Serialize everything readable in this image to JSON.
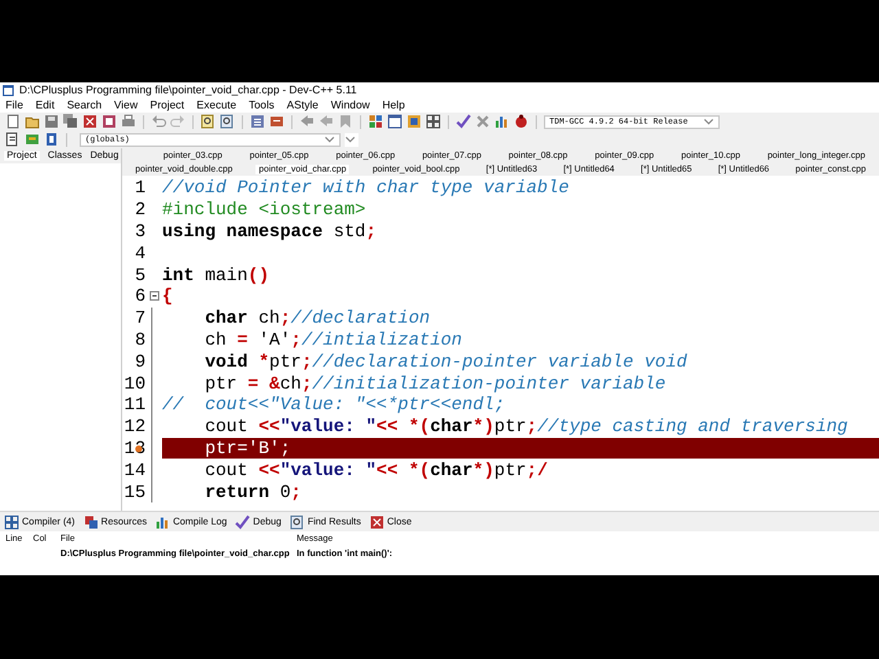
{
  "window": {
    "title": "D:\\CPlusplus Programming file\\pointer_void_char.cpp - Dev-C++ 5.11"
  },
  "menu": [
    "File",
    "Edit",
    "Search",
    "View",
    "Project",
    "Execute",
    "Tools",
    "AStyle",
    "Window",
    "Help"
  ],
  "compiler_select": {
    "value": "TDM-GCC 4.9.2 64-bit Release"
  },
  "scope_select": {
    "value": "(globals)"
  },
  "side_tabs": [
    {
      "label": "Project",
      "selected": true
    },
    {
      "label": "Classes",
      "selected": false
    },
    {
      "label": "Debug",
      "selected": false
    }
  ],
  "file_tab_rows": [
    {
      "tabs": [
        {
          "label": "pointer_03.cpp",
          "selected": false
        },
        {
          "label": "pointer_05.cpp",
          "selected": false
        },
        {
          "label": "pointer_06.cpp",
          "selected": false
        },
        {
          "label": "pointer_07.cpp",
          "selected": false
        },
        {
          "label": "pointer_08.cpp",
          "selected": false
        },
        {
          "label": "pointer_09.cpp",
          "selected": false
        },
        {
          "label": "pointer_10.cpp",
          "selected": false
        },
        {
          "label": "pointer_long_integer.cpp",
          "selected": false
        }
      ]
    },
    {
      "tabs": [
        {
          "label": "pointer_void_double.cpp",
          "selected": false
        },
        {
          "label": "pointer_void_char.cpp",
          "selected": true
        },
        {
          "label": "pointer_void_bool.cpp",
          "selected": false
        },
        {
          "label": "[*] Untitled63",
          "selected": false
        },
        {
          "label": "[*] Untitled64",
          "selected": false
        },
        {
          "label": "[*] Untitled65",
          "selected": false
        },
        {
          "label": "[*] Untitled66",
          "selected": false
        },
        {
          "label": "pointer_const.cpp",
          "selected": false
        }
      ]
    }
  ],
  "editor": {
    "lines": [
      {
        "number": "1",
        "fold": false,
        "error": false,
        "tokens": [
          {
            "kind": "comment",
            "text": "//void Pointer with char type variable"
          }
        ]
      },
      {
        "number": "2",
        "fold": false,
        "error": false,
        "tokens": [
          {
            "kind": "preproc",
            "text": "#include <iostream>"
          }
        ]
      },
      {
        "number": "3",
        "fold": false,
        "error": false,
        "tokens": [
          {
            "kind": "keyword",
            "text": "using namespace"
          },
          {
            "kind": "plain",
            "text": " std"
          },
          {
            "kind": "op",
            "text": ";"
          }
        ]
      },
      {
        "number": "4",
        "fold": false,
        "error": false
      },
      {
        "number": "5",
        "fold": false,
        "error": false,
        "tokens": [
          {
            "kind": "keyword",
            "text": "int"
          },
          {
            "kind": "plain",
            "text": " main"
          },
          {
            "kind": "op",
            "text": "()"
          }
        ]
      },
      {
        "number": "6",
        "fold": true,
        "error": false,
        "tokens": [
          {
            "kind": "op",
            "text": "{"
          }
        ]
      },
      {
        "number": "7",
        "fold": false,
        "error": false,
        "tokens": [
          {
            "kind": "keyword",
            "text": "    char"
          },
          {
            "kind": "plain",
            "text": " ch"
          },
          {
            "kind": "op",
            "text": ";"
          },
          {
            "kind": "comment",
            "text": "//declaration"
          }
        ]
      },
      {
        "number": "8",
        "fold": false,
        "error": false,
        "tokens": [
          {
            "kind": "plain",
            "text": "    ch "
          },
          {
            "kind": "op",
            "text": "="
          },
          {
            "kind": "plain",
            "text": " 'A'"
          },
          {
            "kind": "op",
            "text": ";"
          },
          {
            "kind": "comment",
            "text": "//intialization"
          }
        ]
      },
      {
        "number": "9",
        "fold": false,
        "error": false,
        "tokens": [
          {
            "kind": "keyword",
            "text": "    void"
          },
          {
            "kind": "op",
            "text": " *"
          },
          {
            "kind": "plain",
            "text": "ptr"
          },
          {
            "kind": "op",
            "text": ";"
          },
          {
            "kind": "comment",
            "text": "//declaration-pointer variable void"
          }
        ]
      },
      {
        "number": "10",
        "fold": false,
        "error": false,
        "tokens": [
          {
            "kind": "plain",
            "text": "    ptr "
          },
          {
            "kind": "op",
            "text": "="
          },
          {
            "kind": "op",
            "text": " &"
          },
          {
            "kind": "plain",
            "text": "ch"
          },
          {
            "kind": "op",
            "text": ";"
          },
          {
            "kind": "comment",
            "text": "//initialization-pointer variable"
          }
        ]
      },
      {
        "number": "11",
        "fold": false,
        "error": false,
        "tokens": [
          {
            "kind": "comment",
            "text": "//  cout<<\"Value: \"<<*ptr<<endl;"
          }
        ]
      },
      {
        "number": "12",
        "fold": false,
        "error": false,
        "tokens": [
          {
            "kind": "plain",
            "text": "    cout "
          },
          {
            "kind": "op",
            "text": "<<"
          },
          {
            "kind": "string",
            "text": "\"value: \""
          },
          {
            "kind": "op",
            "text": "<<"
          },
          {
            "kind": "op",
            "text": " *("
          },
          {
            "kind": "keyword",
            "text": "char"
          },
          {
            "kind": "op",
            "text": "*)"
          },
          {
            "kind": "plain",
            "text": "ptr"
          },
          {
            "kind": "op",
            "text": ";"
          },
          {
            "kind": "comment",
            "text": "//type casting and traversing"
          }
        ]
      },
      {
        "number": "13",
        "fold": false,
        "error": true,
        "tokens": [
          {
            "kind": "plain",
            "text": "    ptr='B';"
          }
        ]
      },
      {
        "number": "14",
        "fold": false,
        "error": false,
        "tokens": [
          {
            "kind": "plain",
            "text": "    cout "
          },
          {
            "kind": "op",
            "text": "<<"
          },
          {
            "kind": "string",
            "text": "\"value: \""
          },
          {
            "kind": "op",
            "text": "<<"
          },
          {
            "kind": "op",
            "text": " *("
          },
          {
            "kind": "keyword",
            "text": "char"
          },
          {
            "kind": "op",
            "text": "*)"
          },
          {
            "kind": "plain",
            "text": "ptr"
          },
          {
            "kind": "op",
            "text": ";/"
          }
        ]
      },
      {
        "number": "15",
        "fold": false,
        "error": false,
        "tokens": [
          {
            "kind": "keyword",
            "text": "    return"
          },
          {
            "kind": "plain",
            "text": " 0"
          },
          {
            "kind": "op",
            "text": ";"
          }
        ]
      }
    ]
  },
  "bottom_tabs": [
    "Compiler (4)",
    "Resources",
    "Compile Log",
    "Debug",
    "Find Results",
    "Close"
  ],
  "messages": {
    "columns": [
      "Line",
      "Col",
      "File",
      "Message"
    ],
    "rows": [
      {
        "file": "D:\\CPlusplus Programming file\\pointer_void_char.cpp",
        "message": "In function 'int main()':"
      }
    ]
  }
}
